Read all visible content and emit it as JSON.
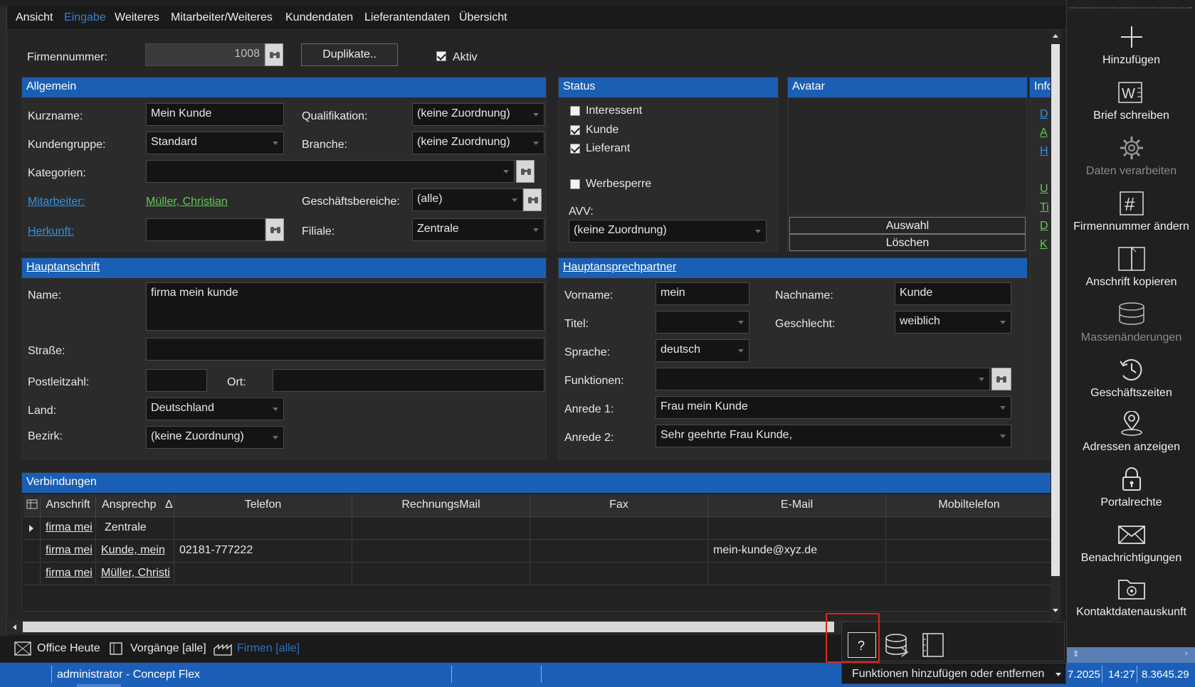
{
  "menu": [
    "Ansicht",
    "Eingabe",
    "Weiteres",
    "Mitarbeiter/Weiteres",
    "Kundendaten",
    "Lieferantendaten",
    "Übersicht"
  ],
  "top": {
    "firmennummer_label": "Firmennummer:",
    "firmennummer_value": "1008",
    "duplikate_label": "Duplikate..",
    "aktiv_label": "Aktiv",
    "aktiv_checked": true
  },
  "allgemein": {
    "title": "Allgemein",
    "kurzname_label": "Kurzname:",
    "kurzname_value": "Mein Kunde",
    "kundengruppe_label": "Kundengruppe:",
    "kundengruppe_value": "Standard",
    "kategorien_label": "Kategorien:",
    "kategorien_value": "",
    "mitarbeiter_label": "Mitarbeiter:",
    "mitarbeiter_value": "Müller, Christian",
    "herkunft_label": "Herkunft:",
    "herkunft_value": "",
    "qualifikation_label": "Qualifikation:",
    "qualifikation_value": "(keine Zuordnung)",
    "branche_label": "Branche:",
    "branche_value": "(keine Zuordnung)",
    "geschaeftsbereiche_label": "Geschäftsbereiche:",
    "geschaeftsbereiche_value": "(alle)",
    "filiale_label": "Filiale:",
    "filiale_value": "Zentrale"
  },
  "status": {
    "title": "Status",
    "interessent_label": "Interessent",
    "interessent_checked": false,
    "kunde_label": "Kunde",
    "kunde_checked": true,
    "lieferant_label": "Lieferant",
    "lieferant_checked": true,
    "werbesperre_label": "Werbesperre",
    "werbesperre_checked": false,
    "avv_label": "AVV:",
    "avv_value": "(keine Zuordnung)"
  },
  "avatar": {
    "title": "Avatar",
    "auswahl_label": "Auswahl",
    "loeschen_label": "Löschen"
  },
  "info": {
    "title": "Info",
    "links": [
      "D",
      "A",
      "H",
      "U",
      "Ti",
      "D",
      "K"
    ]
  },
  "hauptanschrift": {
    "title": "Hauptanschrift",
    "name_label": "Name:",
    "name_value": "firma mein kunde",
    "strasse_label": "Straße:",
    "strasse_value": "",
    "plz_label": "Postleitzahl:",
    "plz_value": "",
    "ort_label": "Ort:",
    "ort_value": "",
    "land_label": "Land:",
    "land_value": "Deutschland",
    "bezirk_label": "Bezirk:",
    "bezirk_value": "(keine Zuordnung)"
  },
  "hauptansprechpartner": {
    "title": "Hauptansprechpartner",
    "vorname_label": "Vorname:",
    "vorname_value": "mein",
    "nachname_label": "Nachname:",
    "nachname_value": "Kunde",
    "titel_label": "Titel:",
    "titel_value": "",
    "geschlecht_label": "Geschlecht:",
    "geschlecht_value": "weiblich",
    "sprache_label": "Sprache:",
    "sprache_value": "deutsch",
    "funktionen_label": "Funktionen:",
    "funktionen_value": "",
    "anrede1_label": "Anrede 1:",
    "anrede1_value": "Frau mein Kunde",
    "anrede2_label": "Anrede 2:",
    "anrede2_value": "Sehr geehrte Frau Kunde,"
  },
  "verbindungen": {
    "title": "Verbindungen",
    "columns": [
      "Anschrift",
      "Ansprechp",
      "Telefon",
      "RechnungsMail",
      "Fax",
      "E-Mail",
      "Mobiltelefon"
    ],
    "sort_indicator": "Δ",
    "rows": [
      {
        "anschrift": "firma mei",
        "ansprechp": "Zentrale",
        "telefon": "",
        "rechnungsmail": "",
        "fax": "",
        "email": "",
        "mobil": ""
      },
      {
        "anschrift": "firma mei",
        "ansprechp": "Kunde, mein",
        "telefon": "02181-777222",
        "rechnungsmail": "",
        "fax": "",
        "email": "mein-kunde@xyz.de",
        "mobil": ""
      },
      {
        "anschrift": "firma mei",
        "ansprechp": "Müller, Christi",
        "telefon": "",
        "rechnungsmail": "",
        "fax": "",
        "email": "",
        "mobil": ""
      }
    ]
  },
  "sidebar": [
    {
      "label": "Hinzufügen",
      "icon": "plus-icon",
      "enabled": true
    },
    {
      "label": "Brief schreiben",
      "icon": "word-document-icon",
      "enabled": true
    },
    {
      "label": "Daten verarbeiten",
      "icon": "gear-icon",
      "enabled": false
    },
    {
      "label": "Firmennummer ändern",
      "icon": "hash-icon",
      "enabled": true
    },
    {
      "label": "Anschrift kopieren",
      "icon": "copy-icon",
      "enabled": true
    },
    {
      "label": "Massenänderungen",
      "icon": "database-icon",
      "enabled": false
    },
    {
      "label": "Geschäftszeiten",
      "icon": "clock-icon",
      "enabled": true
    },
    {
      "label": "Adressen anzeigen",
      "icon": "location-pin-icon",
      "enabled": true
    },
    {
      "label": "Portalrechte",
      "icon": "lock-icon",
      "enabled": true
    },
    {
      "label": "Benachrichtigungen",
      "icon": "envelope-icon",
      "enabled": true
    },
    {
      "label": "Kontaktdatenauskunft",
      "icon": "folder-info-icon",
      "enabled": true
    }
  ],
  "tabs": [
    {
      "label": "Office Heute",
      "active": false
    },
    {
      "label": "Vorgänge [alle]",
      "active": false
    },
    {
      "label": "Firmen [alle]",
      "active": true
    }
  ],
  "tooltip": "Funktionen hinzufügen oder entfernen",
  "status_bar": {
    "user": "administrator - Concept Flex",
    "date": "7.2025",
    "time": "14:27",
    "version": "8.3645.29"
  }
}
